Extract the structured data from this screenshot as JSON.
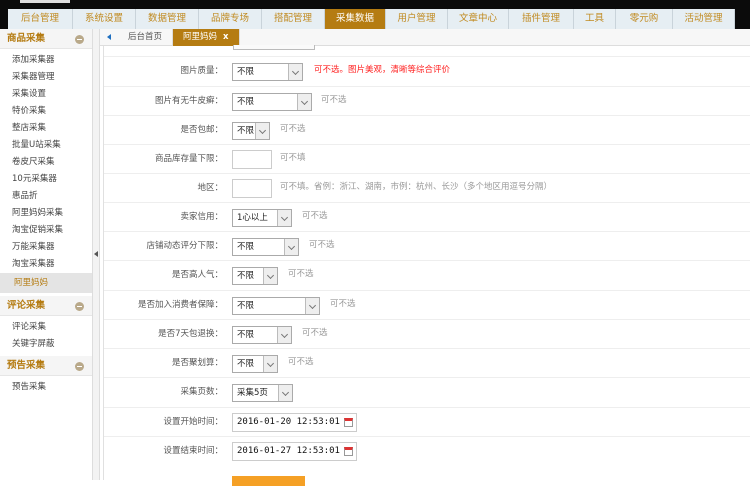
{
  "nav": {
    "tabs": [
      "后台管理",
      "系统设置",
      "数据管理",
      "品牌专场",
      "搭配管理",
      "采集数据",
      "用户管理",
      "文章中心",
      "插件管理",
      "工具",
      "零元购",
      "活动管理"
    ],
    "active": "采集数据"
  },
  "sidebar": {
    "sections": [
      {
        "title": "商品采集",
        "items": [
          "添加采集器",
          "采集器管理",
          "采集设置",
          "特价采集",
          "整店采集",
          "批量U站采集",
          "卷皮尺采集",
          "10元采集器",
          "惠品折",
          "阿里妈妈采集",
          "淘宝促销采集",
          "万能采集器",
          "淘宝采集器",
          "阿里妈妈"
        ],
        "active": "阿里妈妈"
      },
      {
        "title": "评论采集",
        "items": [
          "评论采集",
          "关键字屏蔽"
        ]
      },
      {
        "title": "预告采集",
        "items": [
          "预告采集"
        ]
      }
    ]
  },
  "tabs": {
    "home": "后台首页",
    "current": "阿里妈妈",
    "close": "x"
  },
  "form": {
    "rows": [
      {
        "label": "图片质量：",
        "type": "select",
        "value": "不限",
        "hint": "可不选。图片美观，清晰等综合评价",
        "hint_color": "#ff2222"
      },
      {
        "label": "图片有无牛皮癣：",
        "type": "select",
        "value": "不限",
        "hint": "可不选"
      },
      {
        "label": "是否包邮：",
        "type": "select",
        "value": "不限",
        "hint": "可不选"
      },
      {
        "label": "商品库存量下限：",
        "type": "input",
        "value": "",
        "hint": "可不填"
      },
      {
        "label": "地区：",
        "type": "input",
        "value": "",
        "hint": "可不填。省例：浙江、湖南，市例：杭州、长沙（多个地区用逗号分隔）"
      },
      {
        "label": "卖家信用：",
        "type": "select",
        "value": "1心以上",
        "hint": "可不选"
      },
      {
        "label": "店铺动态评分下限：",
        "type": "select",
        "value": "不限",
        "hint": "可不选"
      },
      {
        "label": "是否高人气：",
        "type": "select",
        "value": "不限",
        "hint": "可不选"
      },
      {
        "label": "是否加入消费者保障：",
        "type": "select",
        "value": "不限",
        "hint": "可不选"
      },
      {
        "label": "是否7天包退换：",
        "type": "select",
        "value": "不限",
        "hint": "可不选"
      },
      {
        "label": "是否聚划算：",
        "type": "select",
        "value": "不限",
        "hint": "可不选"
      },
      {
        "label": "采集页数：",
        "type": "select",
        "value": "采集5页",
        "hint": ""
      },
      {
        "label": "设置开始时间：",
        "type": "date",
        "value": "2016-01-20 12:53:01",
        "hint": ""
      },
      {
        "label": "设置结束时间：",
        "type": "date",
        "value": "2016-01-27 12:53:01",
        "hint": ""
      }
    ]
  },
  "colors": {
    "accent": "#b57c12",
    "button": "#f5a025",
    "warning": "#ff2222"
  }
}
